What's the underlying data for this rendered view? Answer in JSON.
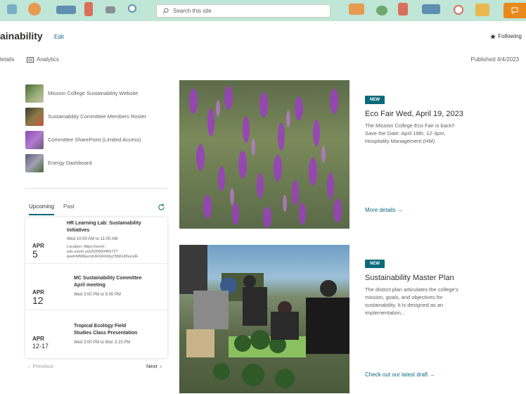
{
  "banner": {
    "search_placeholder": "Search this site"
  },
  "header": {
    "site_title": "ainability",
    "edit_label": "Edit",
    "following_label": "Following"
  },
  "commandbar": {
    "details_label": "letails",
    "analytics_label": "Analytics",
    "published_label": "Published 4/4/2023"
  },
  "quicklinks": [
    {
      "label": "Mission College Sustainability Website"
    },
    {
      "label": "Sustainability Committee Members Roster"
    },
    {
      "label": "Committee SharePoint (Limited Access)"
    },
    {
      "label": "Energy Dashboard"
    }
  ],
  "events_tabs": {
    "upcoming": "Upcoming",
    "past": "Past"
  },
  "events": [
    {
      "month": "APR",
      "day": "5",
      "title": "HR Learning Lab: Sustainability Initiatives",
      "time": "Wed 10:00 AM to 11:00 AM",
      "location": "Location: https://svvm-edu.zoom.us/j/92065045672?pwd=MWtEemlURXlFK0tyZ3NFU0hocHF"
    },
    {
      "month": "APR",
      "day": "12",
      "title": "MC Sustainability Committee April meeting",
      "time": "Wed 3:00 PM to 5:00 PM"
    },
    {
      "month": "APR",
      "day": "12-17",
      "title": "Tropical Ecology Field Studies Class Presentation",
      "time": "Wed 3:00 PM to Mon 3:15 PM"
    }
  ],
  "pager": {
    "previous": "Previous",
    "next": "Next"
  },
  "news": [
    {
      "badge": "NEW",
      "title": "Eco Fair Wed, April 19, 2023",
      "description": "The Mission College Eco Fair is back!! Save the Date: April 19th, 12-3pm, Hospitality Management (HM)",
      "link": "More details"
    },
    {
      "badge": "NEW",
      "title": "Sustainability Master Plan",
      "description": "The district plan articulates the college's mission, goals, and objectives for sustainability. It is designed as an implementation...",
      "link": "Check out our latest draft"
    }
  ],
  "colors": {
    "accent": "#0b6a7a",
    "banner": "#bfe6d6",
    "chat": "#e8891c"
  }
}
